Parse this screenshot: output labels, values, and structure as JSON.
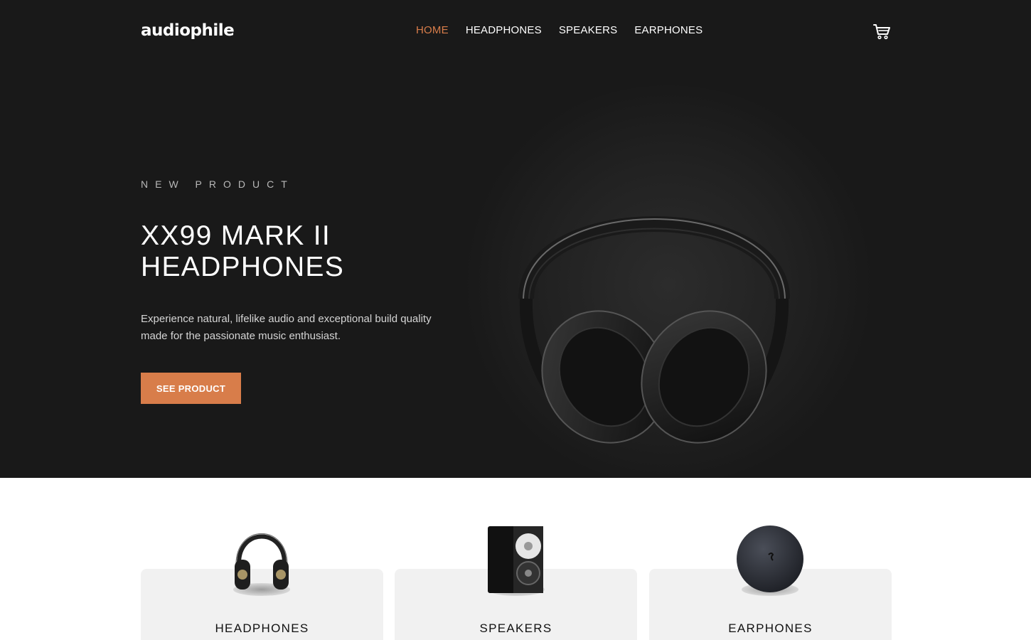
{
  "header": {
    "logo": "audiophile",
    "nav": [
      {
        "label": "HOME",
        "active": true
      },
      {
        "label": "HEADPHONES",
        "active": false
      },
      {
        "label": "SPEAKERS",
        "active": false
      },
      {
        "label": "EARPHONES",
        "active": false
      }
    ],
    "cart_icon": "cart-icon"
  },
  "hero": {
    "overline": "NEW PRODUCT",
    "title": "XX99 MARK II HEADPHONES",
    "description": "Experience natural, lifelike audio and exceptional build quality made for the passionate music enthusiast.",
    "cta_label": "SEE PRODUCT"
  },
  "categories": [
    {
      "label": "HEADPHONES",
      "icon": "headphones-thumbnail"
    },
    {
      "label": "SPEAKERS",
      "icon": "speaker-thumbnail"
    },
    {
      "label": "EARPHONES",
      "icon": "earphones-case-thumbnail"
    }
  ],
  "colors": {
    "accent": "#d87d4a",
    "dark": "#191919",
    "card_bg": "#f1f1f1"
  }
}
